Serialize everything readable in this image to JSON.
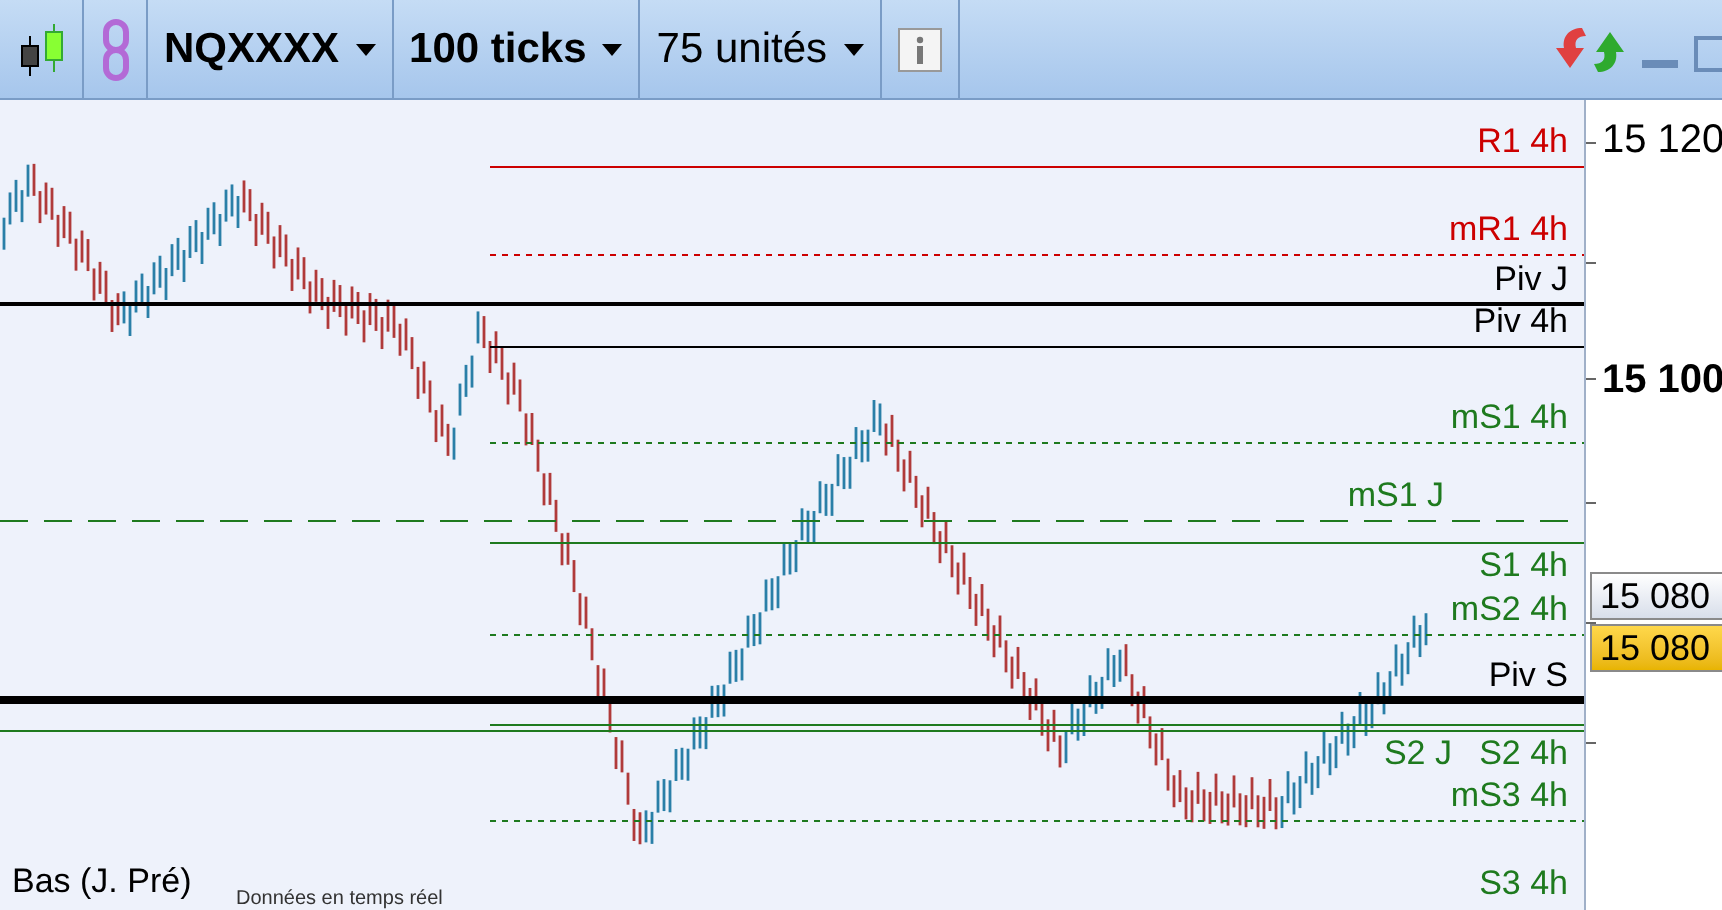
{
  "toolbar": {
    "instrument": "NQXXXX",
    "period": "100 ticks",
    "units": "75 unités"
  },
  "levels": [
    {
      "label": "R1 4h",
      "kind": "solid",
      "color": "#cc0000"
    },
    {
      "label": "mR1 4h",
      "kind": "dashed",
      "color": "#cc0000"
    },
    {
      "label": "Piv J",
      "kind": "medium",
      "color": "#000000"
    },
    {
      "label": "Piv 4h",
      "kind": "solid",
      "color": "#000000"
    },
    {
      "label": "mS1 4h",
      "kind": "dashed",
      "color": "#1e7a1e"
    },
    {
      "label": "mS1 J",
      "kind": "longdash",
      "color": "#1e7a1e"
    },
    {
      "label": "S1 4h",
      "kind": "solid",
      "color": "#1e7a1e"
    },
    {
      "label": "mS2 4h",
      "kind": "dashed",
      "color": "#1e7a1e"
    },
    {
      "label": "Piv S",
      "kind": "thick",
      "color": "#000000"
    },
    {
      "label": "S2 J",
      "kind": "solid",
      "color": "#1e7a1e"
    },
    {
      "label": "S2 4h",
      "kind": "solid",
      "color": "#1e7a1e"
    },
    {
      "label": "mS3 4h",
      "kind": "dashed",
      "color": "#1e7a1e"
    },
    {
      "label": "S3 4h",
      "kind": "none",
      "color": "#1e7a1e"
    }
  ],
  "axis": {
    "ticks": [
      {
        "label": "15 120",
        "bold": false
      },
      {
        "label": "15 100",
        "bold": true
      }
    ],
    "price_tags": [
      {
        "label": "15 080",
        "kind": "last"
      },
      {
        "label": "15 080",
        "kind": "highlight"
      }
    ]
  },
  "footer": {
    "label": "Bas (J. Pré)",
    "notice": "Données en temps réel"
  }
}
